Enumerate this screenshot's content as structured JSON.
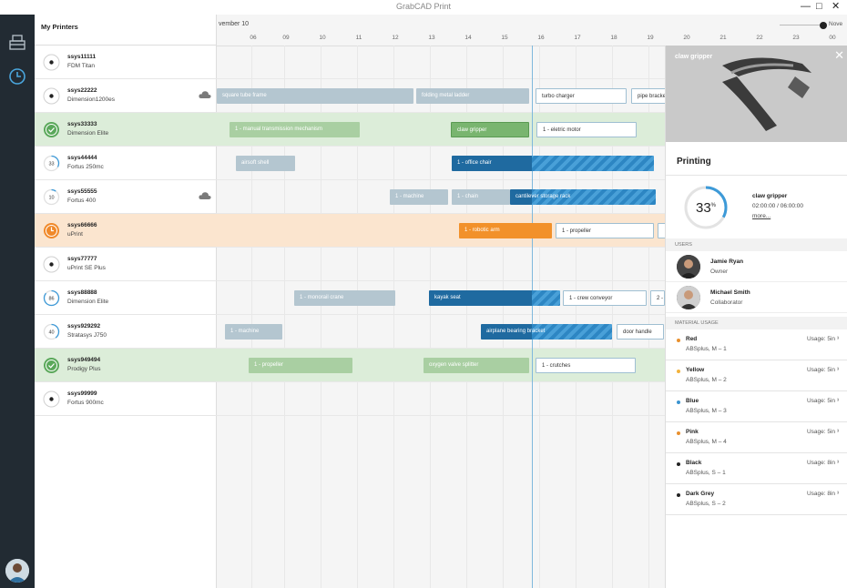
{
  "app": {
    "title": "GrabCAD Print",
    "window_controls": {
      "minimize": "—",
      "maximize": "□",
      "close": "✕"
    }
  },
  "nav": {
    "icons": [
      "printer-queue-icon",
      "clock-icon"
    ],
    "active": "clock-icon"
  },
  "printers_header": "My Printers",
  "printers": [
    {
      "name": "ssys11111",
      "model": "FDM Titan",
      "status": "idle"
    },
    {
      "name": "ssys22222",
      "model": "Dimension1200es",
      "status": "idle",
      "cloud": true
    },
    {
      "name": "ssys33333",
      "model": "Dimension Elite",
      "status": "done",
      "highlight": "green"
    },
    {
      "name": "ssys44444",
      "model": "Fortus 250mc",
      "status": "progress",
      "progress_label": "33"
    },
    {
      "name": "ssys55555",
      "model": "Fortus 400",
      "status": "progress",
      "progress_label": "10",
      "cloud": true
    },
    {
      "name": "ssys66666",
      "model": "uPrint",
      "status": "warning",
      "highlight": "orange"
    },
    {
      "name": "ssys77777",
      "model": "uPrint SE Plus",
      "status": "idle"
    },
    {
      "name": "ssys88888",
      "model": "Dimension Elite",
      "status": "progress",
      "progress_label": "86"
    },
    {
      "name": "ssys929292",
      "model": "Stratasys J750",
      "status": "progress",
      "progress_label": "40"
    },
    {
      "name": "ssys949494",
      "model": "Prodigy Plus",
      "status": "done",
      "highlight": "green"
    },
    {
      "name": "ssys99999",
      "model": "Fortus 900mc",
      "status": "idle"
    }
  ],
  "timeline": {
    "month_label": "vember 10",
    "next_month_label": "Nove",
    "days": [
      "06",
      "09",
      "10",
      "11",
      "12",
      "13",
      "14",
      "15",
      "16",
      "17",
      "18",
      "19",
      "20",
      "21",
      "22",
      "23",
      "00"
    ],
    "jobs": [
      {
        "row": 1,
        "label": "square tube frame",
        "kind": "past"
      },
      {
        "row": 1,
        "label": "folding metal ladder",
        "kind": "past"
      },
      {
        "row": 1,
        "label": "turbo charger",
        "kind": "queued"
      },
      {
        "row": 1,
        "label": "pipe bracket",
        "kind": "queued"
      },
      {
        "row": 2,
        "label": "1 - manual transmission mechanism",
        "kind": "pastg"
      },
      {
        "row": 2,
        "label": "claw gripper",
        "kind": "gs"
      },
      {
        "row": 2,
        "label": "1 - eletric motor",
        "kind": "queued"
      },
      {
        "row": 3,
        "label": "airsoft shell",
        "kind": "past"
      },
      {
        "row": 3,
        "label": "1 - office chair",
        "kind": "active"
      },
      {
        "row": 4,
        "label": "1 - machine",
        "kind": "past"
      },
      {
        "row": 4,
        "label": "1 - chain",
        "kind": "past"
      },
      {
        "row": 4,
        "label": "cantilever storage rack",
        "kind": "active"
      },
      {
        "row": 5,
        "label": "1 - robotic arm",
        "kind": "orangej"
      },
      {
        "row": 5,
        "label": "1 - propeller",
        "kind": "queued"
      },
      {
        "row": 5,
        "label": "",
        "kind": "queued"
      },
      {
        "row": 7,
        "label": "1 - monorail crane",
        "kind": "past"
      },
      {
        "row": 7,
        "label": "kayak seat",
        "kind": "active"
      },
      {
        "row": 7,
        "label": "1 - crew conveyor",
        "kind": "queued"
      },
      {
        "row": 7,
        "label": "2 -",
        "kind": "queued"
      },
      {
        "row": 8,
        "label": "1 - machine",
        "kind": "past"
      },
      {
        "row": 8,
        "label": "airplane bearing bracket",
        "kind": "active"
      },
      {
        "row": 8,
        "label": "door handle",
        "kind": "queued"
      },
      {
        "row": 9,
        "label": "1 - propeller",
        "kind": "pastg"
      },
      {
        "row": 9,
        "label": "oxygen valve splitter",
        "kind": "pastg"
      },
      {
        "row": 9,
        "label": "1 - crutches",
        "kind": "queued"
      }
    ]
  },
  "panel": {
    "image_title": "claw gripper",
    "close": "✕",
    "status_title": "Printing",
    "progress": 33,
    "progress_label": "33",
    "progress_unit": "%",
    "job_name": "claw gripper",
    "job_time": "02:00:00 / 06:00:00",
    "more_link": "more...",
    "users_header": "USERS",
    "users": [
      {
        "name": "Jamie Ryan",
        "role": "Owner"
      },
      {
        "name": "Michael Smith",
        "role": "Collaborator"
      }
    ],
    "material_header": "MATERIAL USAGE",
    "materials": [
      {
        "name": "Red",
        "desc": "ABSplus, M – 1",
        "usage": "Usage: 5in ³",
        "color": "#e9902e"
      },
      {
        "name": "Yellow",
        "desc": "ABSplus, M – 2",
        "usage": "Usage: 5in ³",
        "color": "#f3b33c"
      },
      {
        "name": "Blue",
        "desc": "ABSplus, M – 3",
        "usage": "Usage: 5in ³",
        "color": "#3a94d0"
      },
      {
        "name": "Pink",
        "desc": "ABSplus, M – 4",
        "usage": "Usage: 5in ³",
        "color": "#e9902e"
      },
      {
        "name": "Black",
        "desc": "ABSplus, S – 1",
        "usage": "Usage: 8in ³",
        "color": "#222222"
      },
      {
        "name": "Dark Grey",
        "desc": "ABSplus, S – 2",
        "usage": "Usage: 8in ³",
        "color": "#222222"
      }
    ]
  }
}
